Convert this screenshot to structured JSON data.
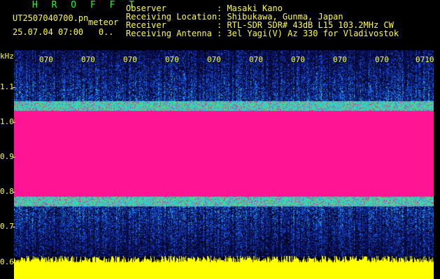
{
  "header": {
    "brand": "H R O F F T",
    "file_name": "UT2507040700.pn",
    "tag": "meteor",
    "date_time": "25.07.04 07:00",
    "extra": "0..",
    "fields": [
      {
        "label": "Observer",
        "value": ": Masaki Kano"
      },
      {
        "label": "Receiving Location",
        "value": ": Shibukawa, Gunma, Japan"
      },
      {
        "label": "Receiver",
        "value": ": RTL-SDR SDR# 43dB L15 103.2MHz CW"
      },
      {
        "label": "Receiving Antenna",
        "value": ": 3el Yagi(V) Az 330 for Vladivostok"
      }
    ]
  },
  "axis": {
    "unit": "kHz",
    "y_ticks": [
      "1.1",
      "1.0",
      "0.9",
      "0.8",
      "0.7",
      "0.6"
    ],
    "x_ticks": [
      "070",
      "070",
      "070",
      "070",
      "070",
      "070",
      "070",
      "070",
      "070",
      "0710"
    ]
  },
  "colors": {
    "label": "#ffff33",
    "brand": "#22ff22",
    "signal": "#ff1493",
    "noise_floor": "#ffff00"
  }
}
